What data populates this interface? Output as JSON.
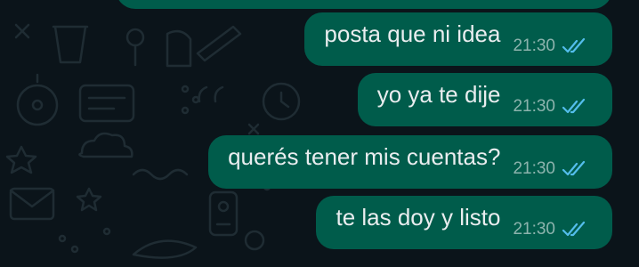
{
  "colors": {
    "background": "#0b141a",
    "bubble_outgoing": "#005c4b",
    "text": "#e9edef",
    "read_ticks": "#53bdeb"
  },
  "messages": [
    {
      "text": "posta que ni idea",
      "time": "21:30",
      "status_icon": "double-check-read-icon"
    },
    {
      "text": "yo ya te dije",
      "time": "21:30",
      "status_icon": "double-check-read-icon"
    },
    {
      "text": "querés tener mis cuentas?",
      "time": "21:30",
      "status_icon": "double-check-read-icon"
    },
    {
      "text": "te las doy y listo",
      "time": "21:30",
      "status_icon": "double-check-read-icon"
    }
  ]
}
